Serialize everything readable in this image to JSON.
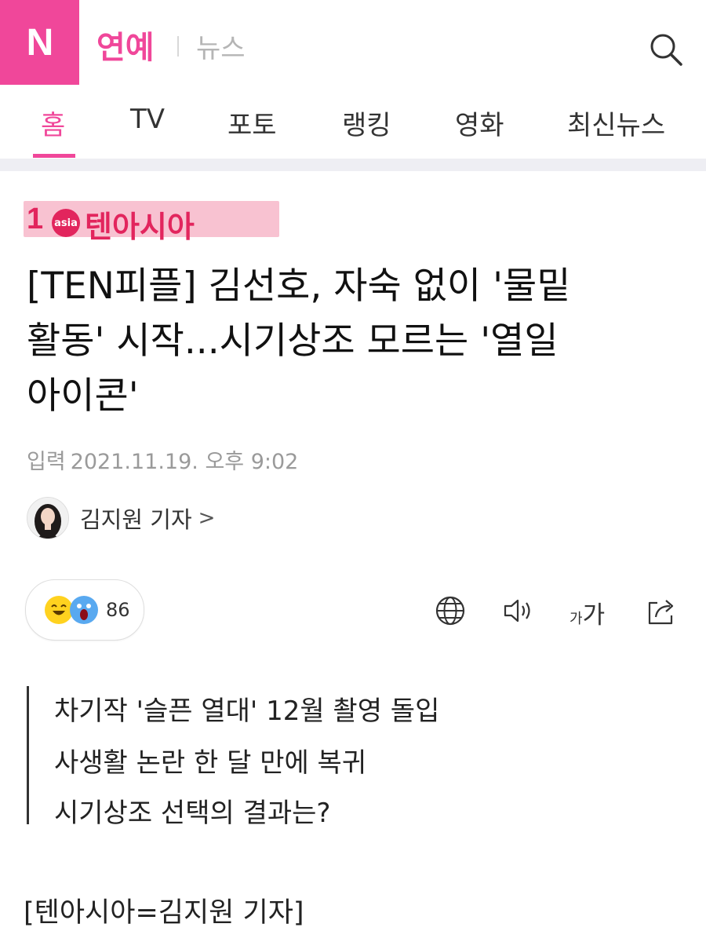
{
  "header": {
    "logo_letter": "N",
    "section_title": "연예",
    "sub_title": "뉴스"
  },
  "nav": {
    "tabs": [
      "홈",
      "TV",
      "포토",
      "랭킹",
      "영화",
      "최신뉴스"
    ],
    "active_index": 0
  },
  "press": {
    "logo_mark": "1",
    "logo_dot": "asia",
    "name": "텐아시아"
  },
  "article": {
    "headline_lines": [
      "[TEN피플] 김선호, 자숙 없이 '물밑",
      "활동' 시작...시기상조 모르는 '열일",
      "아이콘'"
    ],
    "date_label": "입력",
    "date_value": "2021.11.19. 오후 9:02",
    "reporter": "김지원 기자",
    "reporter_chevron": ">"
  },
  "reactions": {
    "count": "86"
  },
  "tools": {
    "font_small": "가",
    "font_big": "가"
  },
  "summary": [
    "차기작 '슬픈 열대' 12월 촬영 돌입",
    "사생활 논란 한 달 만에 복귀",
    "시기상조 선택의 결과는?"
  ],
  "byline": "[텐아시아=김지원 기자]",
  "colors": {
    "brand_pink": "#f0479a",
    "press_red": "#e2255d",
    "highlight_pink": "#f7b7c9"
  }
}
